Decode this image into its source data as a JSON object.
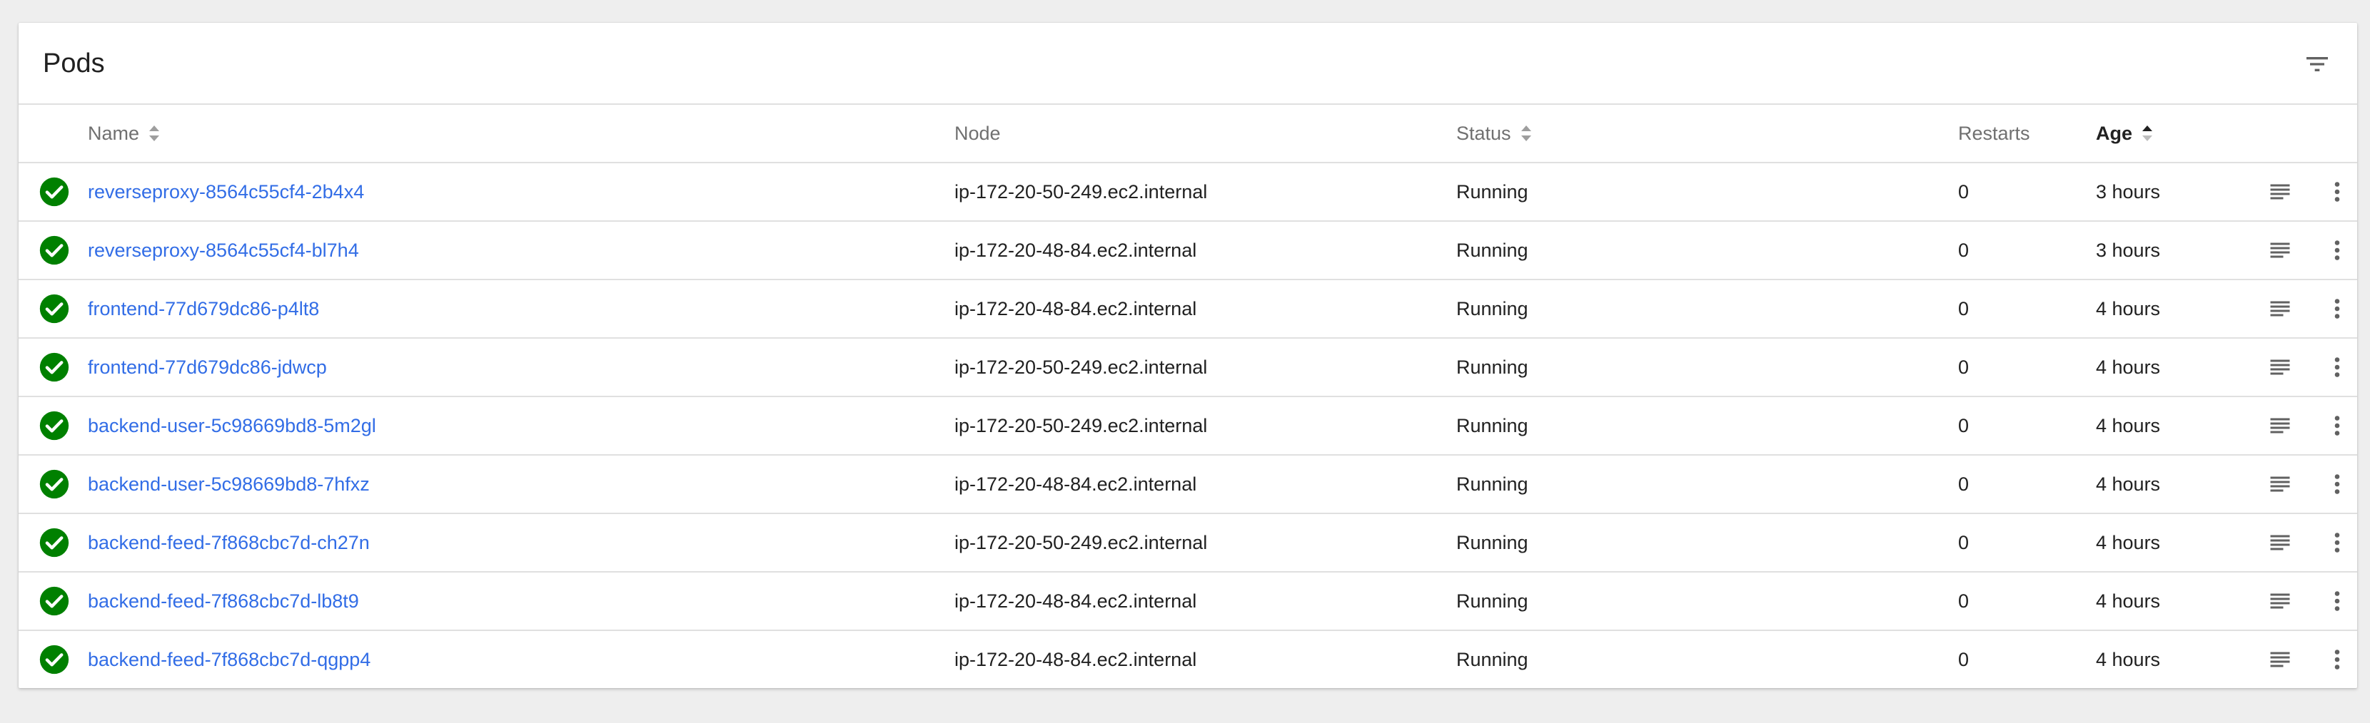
{
  "card": {
    "title": "Pods"
  },
  "columns": {
    "name": "Name",
    "node": "Node",
    "status": "Status",
    "restarts": "Restarts",
    "age": "Age",
    "sorted_by": "age"
  },
  "colors": {
    "link": "#326de6",
    "success": "#008000",
    "header_text": "#707070",
    "icon": "#616161"
  },
  "icons": {
    "filter": "filter-icon",
    "status": "check-circle-icon",
    "logs": "logs-icon",
    "menu": "more-vert-icon"
  },
  "pods": [
    {
      "name": "reverseproxy-8564c55cf4-2b4x4",
      "node": "ip-172-20-50-249.ec2.internal",
      "status": "Running",
      "restarts": "0",
      "age": "3 hours"
    },
    {
      "name": "reverseproxy-8564c55cf4-bl7h4",
      "node": "ip-172-20-48-84.ec2.internal",
      "status": "Running",
      "restarts": "0",
      "age": "3 hours"
    },
    {
      "name": "frontend-77d679dc86-p4lt8",
      "node": "ip-172-20-48-84.ec2.internal",
      "status": "Running",
      "restarts": "0",
      "age": "4 hours"
    },
    {
      "name": "frontend-77d679dc86-jdwcp",
      "node": "ip-172-20-50-249.ec2.internal",
      "status": "Running",
      "restarts": "0",
      "age": "4 hours"
    },
    {
      "name": "backend-user-5c98669bd8-5m2gl",
      "node": "ip-172-20-50-249.ec2.internal",
      "status": "Running",
      "restarts": "0",
      "age": "4 hours"
    },
    {
      "name": "backend-user-5c98669bd8-7hfxz",
      "node": "ip-172-20-48-84.ec2.internal",
      "status": "Running",
      "restarts": "0",
      "age": "4 hours"
    },
    {
      "name": "backend-feed-7f868cbc7d-ch27n",
      "node": "ip-172-20-50-249.ec2.internal",
      "status": "Running",
      "restarts": "0",
      "age": "4 hours"
    },
    {
      "name": "backend-feed-7f868cbc7d-lb8t9",
      "node": "ip-172-20-48-84.ec2.internal",
      "status": "Running",
      "restarts": "0",
      "age": "4 hours"
    },
    {
      "name": "backend-feed-7f868cbc7d-qgpp4",
      "node": "ip-172-20-48-84.ec2.internal",
      "status": "Running",
      "restarts": "0",
      "age": "4 hours"
    }
  ]
}
